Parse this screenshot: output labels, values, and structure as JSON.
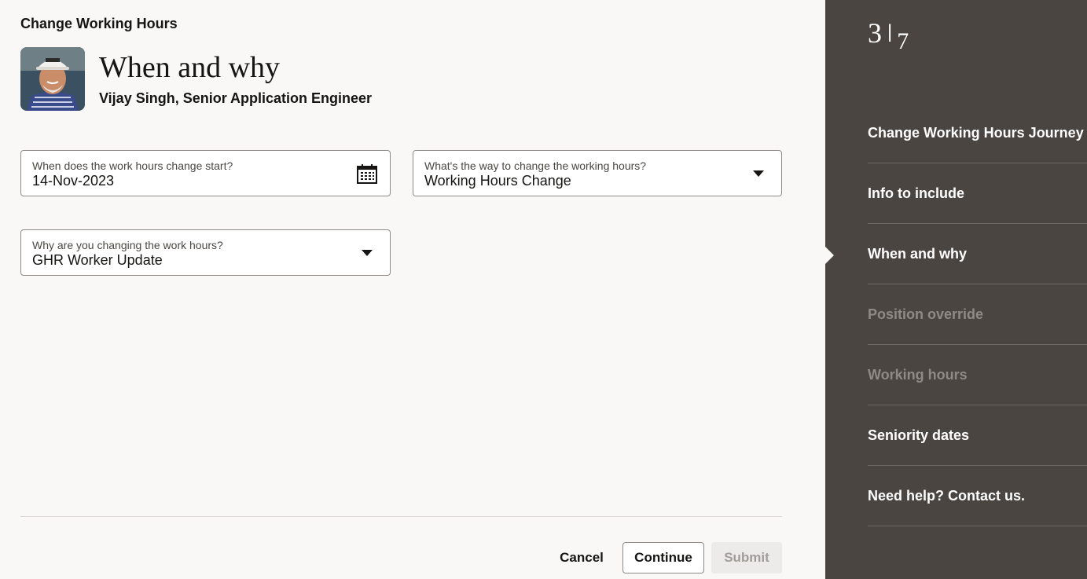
{
  "header": {
    "flow_title": "Change Working Hours",
    "page_heading": "When and why",
    "person": "Vijay Singh, Senior Application Engineer"
  },
  "form": {
    "start_date": {
      "label": "When does the work hours change start?",
      "value": "14-Nov-2023",
      "icon": "calendar-icon"
    },
    "change_way": {
      "label": "What's the way to change the working hours?",
      "value": "Working Hours Change"
    },
    "reason": {
      "label": "Why are you changing the work hours?",
      "value": "GHR Worker Update"
    }
  },
  "footer": {
    "cancel": "Cancel",
    "continue": "Continue",
    "submit": "Submit"
  },
  "sidebar": {
    "step_current": "3",
    "step_separator": "|",
    "step_total": "7",
    "items": [
      {
        "label": "Change Working Hours Journey",
        "enabled": true
      },
      {
        "label": "Info to include",
        "enabled": true
      },
      {
        "label": "When and why",
        "enabled": true,
        "current": true
      },
      {
        "label": "Position override",
        "enabled": false
      },
      {
        "label": "Working hours",
        "enabled": false
      },
      {
        "label": "Seniority dates",
        "enabled": true
      },
      {
        "label": "Need help? Contact us.",
        "enabled": true
      }
    ]
  },
  "colors": {
    "sidebar_bg": "#4a4541",
    "page_bg": "#f9f8f6",
    "disabled_text": "#8f8a85"
  }
}
